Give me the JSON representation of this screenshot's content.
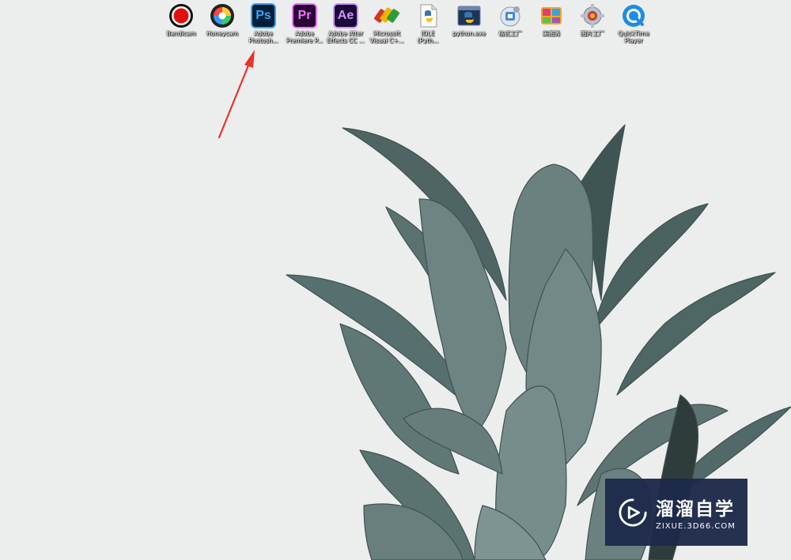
{
  "dock": {
    "items": [
      {
        "label": "Bandicam",
        "icon": "bandicam-record-icon",
        "glyph": "",
        "color": "#e11010"
      },
      {
        "label": "Honeycam",
        "icon": "honeycam-color-wheel-icon",
        "glyph": "",
        "color": "#222222"
      },
      {
        "label": "Adobe\nPhotosh...",
        "icon": "photoshop-icon",
        "glyph": "Ps",
        "color": "#31a8ff"
      },
      {
        "label": "Adobe\nPremiere P...",
        "icon": "premiere-icon",
        "glyph": "Pr",
        "color": "#ea77ff"
      },
      {
        "label": "Adobe After\nEffects CC ...",
        "icon": "after-effects-icon",
        "glyph": "Ae",
        "color": "#d291ff"
      },
      {
        "label": "Microsoft\nVisual C+...",
        "icon": "visual-cpp-icon",
        "glyph": "",
        "color": "#d0342c"
      },
      {
        "label": "IDLE\n(Pyth...",
        "icon": "python-idle-file-icon",
        "glyph": "",
        "color": "#3a75b0"
      },
      {
        "label": "python.exe",
        "icon": "python-exe-icon",
        "glyph": "",
        "color": "#3a75b0"
      },
      {
        "label": "格式工厂",
        "icon": "format-factory-icon",
        "glyph": "",
        "color": "#4a8ad8"
      },
      {
        "label": "美图秀",
        "icon": "meitu-icon",
        "glyph": "",
        "color": "#e04070"
      },
      {
        "label": "图片工厂",
        "icon": "picture-factory-gear-icon",
        "glyph": "",
        "color": "#cc3344"
      },
      {
        "label": "QuickTime\nPlayer",
        "icon": "quicktime-icon",
        "glyph": "",
        "color": "#1e8ce6"
      }
    ]
  },
  "annotation": {
    "arrow_color": "#e8332a",
    "points_to": "Adobe Photoshop"
  },
  "watermark": {
    "title": "溜溜自学",
    "url": "ZIXUE.3D66.COM",
    "logo": "play-logo-icon",
    "bg": "#1e2a4a"
  },
  "wallpaper": {
    "subject": "pineapple-crown-photo",
    "bg": "#eceeed",
    "leaf": "#5e7573"
  }
}
